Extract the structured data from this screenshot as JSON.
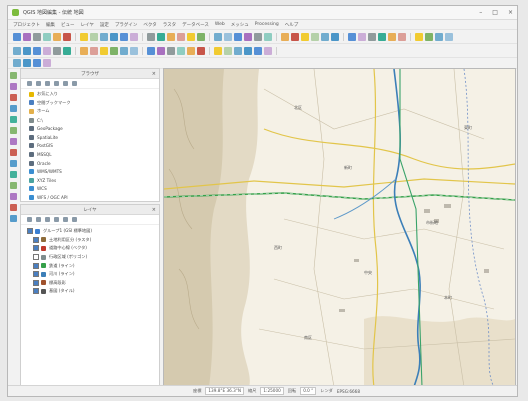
{
  "window": {
    "title": "QGIS 地図編集 - 伝統 地図",
    "minimize_glyph": "–",
    "maximize_glyph": "□",
    "close_glyph": "×"
  },
  "menubar": {
    "items": [
      "プロジェクト",
      "編集",
      "ビュー",
      "レイヤ",
      "設定",
      "プラグイン",
      "ベクタ",
      "ラスタ",
      "データベース",
      "Web",
      "メッシュ",
      "Processing",
      "ヘルプ"
    ]
  },
  "browser_panel": {
    "title": "ブラウザ",
    "close_glyph": "×",
    "items": [
      {
        "label": "お気に入り",
        "icon": "star-icon"
      },
      {
        "label": "空間ブックマーク",
        "icon": "bookmark-icon"
      },
      {
        "label": "ホーム",
        "icon": "folder-icon"
      },
      {
        "label": "C:\\",
        "icon": "drive-icon"
      },
      {
        "label": "GeoPackage",
        "icon": "database-icon"
      },
      {
        "label": "SpatiaLite",
        "icon": "database-icon"
      },
      {
        "label": "PostGIS",
        "icon": "database-icon"
      },
      {
        "label": "MSSQL",
        "icon": "database-icon"
      },
      {
        "label": "Oracle",
        "icon": "database-icon"
      },
      {
        "label": "WMS/WMTS",
        "icon": "globe-icon"
      },
      {
        "label": "XYZ Tiles",
        "icon": "grid-icon"
      },
      {
        "label": "WCS",
        "icon": "globe-icon"
      },
      {
        "label": "WFS / OGC API",
        "icon": "globe-icon"
      }
    ]
  },
  "layers_panel": {
    "title": "レイヤ",
    "close_glyph": "×",
    "items": [
      {
        "label": "グループ1 (GSI 標準地図)",
        "checked": true
      },
      {
        "label": "土地利用区分 (ラスタ)",
        "checked": true
      },
      {
        "label": "道路中心線 (ベクタ)",
        "checked": true
      },
      {
        "label": "行政区域 (ポリゴン)",
        "checked": false
      },
      {
        "label": "鉄道 (ライン)",
        "checked": true
      },
      {
        "label": "河川 (ライン)",
        "checked": true
      },
      {
        "label": "標高段彩",
        "checked": true
      },
      {
        "label": "基図 (タイル)",
        "checked": true
      }
    ]
  },
  "statusbar": {
    "coordinate_label": "座標",
    "coordinate_value": "139.8°E 36.3°N",
    "scale_label": "縮尺",
    "scale_value": "1:25000",
    "rotation_label": "回転",
    "rotation_value": "0.0 °",
    "render_label": "レンダ",
    "crs": "EPSG:6668"
  },
  "map": {
    "labels": [
      "市街地",
      "新町",
      "東町",
      "中央",
      "北区",
      "南区",
      "本町",
      "西町"
    ]
  },
  "colors": {
    "relief": "#d9cfb6",
    "river": "#3c7fb8",
    "railway": "#35a04a",
    "road_major": "#e0c33b",
    "road_minor": "#bfb6a0"
  }
}
